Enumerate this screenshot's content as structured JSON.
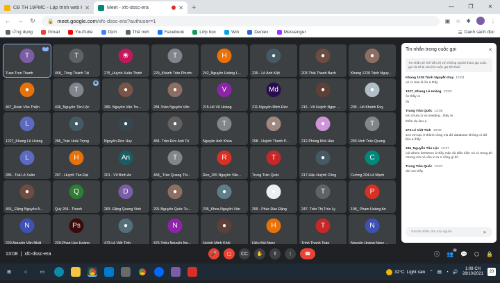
{
  "browser": {
    "tabs": [
      {
        "title": "CĐ TH 19PMC - Lập trình web PH",
        "favicon_color": "#f4b400",
        "active": false
      },
      {
        "title": "Meet - xfc-dssc-era",
        "favicon_color": "#00897b",
        "active": true
      }
    ],
    "url_host": "meet.google.com",
    "url_path": "/xfc-dssc-era?authuser=1",
    "bookmarks": [
      {
        "label": "Ứng dụng",
        "color": "#5f6368"
      },
      {
        "label": "Gmail",
        "color": "#ea4335"
      },
      {
        "label": "YouTube",
        "color": "#ff0000"
      },
      {
        "label": "Dịch",
        "color": "#4285f4"
      },
      {
        "label": "Thẻ mới",
        "color": "#5f6368"
      },
      {
        "label": "Facebook",
        "color": "#1877f2"
      },
      {
        "label": "Lớp học",
        "color": "#0f9d58"
      },
      {
        "label": "Win",
        "color": "#00a4ef"
      },
      {
        "label": "Deniex",
        "color": "#3367d6"
      },
      {
        "label": "Messenger",
        "color": "#a033ff"
      }
    ],
    "reading_list": "Danh sách đọc"
  },
  "participants": [
    {
      "name": "Tuan Tran Thanh",
      "initial": "T",
      "color": "#7b5ea7",
      "selected": true
    },
    {
      "name": "458_ Tống Thành Tài",
      "initial": "T",
      "color": "#5f6368"
    },
    {
      "name": "275_Huỳnh Xuân Thịnh",
      "initial": "❀",
      "color": "#c2185b"
    },
    {
      "name": "229_Khánh Trần Phước",
      "initial": "T",
      "color": "#80868b"
    },
    {
      "name": "242_Nguyễn Hoàng L...",
      "initial": "H",
      "color": "#e8710a"
    },
    {
      "name": "239 - Lê Anh Kiệt",
      "initial": "●",
      "color": "#455a64"
    },
    {
      "name": "203-Thái Thanh Bạch",
      "initial": "●",
      "color": "#6d4c41"
    },
    {
      "name": "Khang 1228 Trịnh Nguy...",
      "initial": "●",
      "color": "#8d6e63"
    },
    {
      "name": "467_Đoàn Văn Thiện",
      "initial": "●",
      "color": "#e8710a"
    },
    {
      "name": "436_Nguyễn Tấn Lộc",
      "initial": "T",
      "color": "#80868b"
    },
    {
      "name": "289- Nguyễn Văn Tru...",
      "initial": "●",
      "color": "#795548"
    },
    {
      "name": "284-Toàn Nguyễn Văn",
      "initial": "●",
      "color": "#8d6e63"
    },
    {
      "name": "215-Hồ Vũ Hoàng",
      "initial": "V",
      "color": "#8e24aa"
    },
    {
      "name": "211-Nguyễn Minh Đức",
      "initial": "Md",
      "color": "#2a0b4f"
    },
    {
      "name": "216 - Võ Huỳnh Ngọc ...",
      "initial": "●",
      "color": "#5d4037"
    },
    {
      "name": "205 - Hồ Khánh Duy",
      "initial": "●",
      "color": "#b0bec5"
    },
    {
      "name": "1227_Khang Lê Hoàng",
      "initial": "L",
      "color": "#5c6bc0"
    },
    {
      "name": "286_Trần Hoài Trọng",
      "initial": "●",
      "color": "#455a64"
    },
    {
      "name": "Nguyễn Đức Huy",
      "initial": "●",
      "color": "#37474f"
    },
    {
      "name": "484- Trần Đức Anh Tú",
      "initial": "●",
      "color": "#616161"
    },
    {
      "name": "Nguyễn Anh Khoa",
      "initial": "T",
      "color": "#80868b"
    },
    {
      "name": "298 - Huỳnh Thanh P...",
      "initial": "●",
      "color": "#a1887f"
    },
    {
      "name": "212-Phùng Khả Hào",
      "initial": "●",
      "color": "#ce93d8"
    },
    {
      "name": "293-Vinh Trần Quang",
      "initial": "T",
      "color": "#80868b"
    },
    {
      "name": "285 - Toả Lê Xuân",
      "initial": "L",
      "color": "#5c6bc0"
    },
    {
      "name": "207 - Huỳnh Tấn Đạt",
      "initial": "H",
      "color": "#e8710a"
    },
    {
      "name": "201 - Võ Bình An",
      "initial": "An",
      "color": "#1a5e63"
    },
    {
      "name": "468_ Trần Quang Thi...",
      "initial": "T",
      "color": "#80868b"
    },
    {
      "name": "Ren_265 Nguyễn Văn...",
      "initial": "R",
      "color": "#d93025"
    },
    {
      "name": "Trung Trần Quốc",
      "initial": "T",
      "color": "#c62828"
    },
    {
      "name": "217-Hậu Huỳnh Công",
      "initial": "●",
      "color": "#455a64"
    },
    {
      "name": "Cường 204-Lê Mạnh",
      "initial": "C",
      "color": "#00897b"
    },
    {
      "name": "466_ Đặng Nguyễn A...",
      "initial": "●",
      "color": "#6d4c41"
    },
    {
      "name": "Quý 264 - Thanh",
      "initial": "Q",
      "color": "#2e7d32"
    },
    {
      "name": "283- Đặng Quang Vinh",
      "initial": "D",
      "color": "#7b5ea7"
    },
    {
      "name": "291-Nguyễn Quốc Tu...",
      "initial": "●",
      "color": "#8d6e63"
    },
    {
      "name": "235_Khoa Nguyễn Văn",
      "initial": "●",
      "color": "#607d8b"
    },
    {
      "name": "259 - Phúc Đào Đặng",
      "initial": "●",
      "color": "#eceff1"
    },
    {
      "name": "247- Trần Thị Trúc Ly",
      "initial": "T",
      "color": "#5f6368"
    },
    {
      "name": "198_ Phạm Hoàng An",
      "initial": "P",
      "color": "#d93025"
    },
    {
      "name": "220-Nguyễn Văn Nhật",
      "initial": "N",
      "color": "#3f51b5"
    },
    {
      "name": "220-Phan Huy Hoàng",
      "initial": "Ps",
      "color": "#3b0a0a"
    },
    {
      "name": "473-Lê Việt Tình",
      "initial": "●",
      "color": "#546e7a"
    },
    {
      "name": "476-Triều Nguyễn Ng...",
      "initial": "N",
      "color": "#8e24aa"
    },
    {
      "name": "Huỳnh Minh Khôi",
      "initial": "●",
      "color": "#5d4037"
    },
    {
      "name": "Hiếu Bùi Ngọc",
      "initial": "H",
      "color": "#e8710a"
    },
    {
      "name": "Trịnh Thanh Toàn",
      "initial": "T",
      "color": "#c62828"
    },
    {
      "name": "Nguyễn Hoàng Ngọc ...",
      "initial": "N",
      "color": "#3f51b5"
    }
  ],
  "chat": {
    "title": "Tin nhắn trong cuộc gọi",
    "notice": "Tin nhắn sẽ chỉ hiển thị với những người tham gia cuộc gọi và sẽ bị xóa khi cuộc gọi kết thúc",
    "messages": [
      {
        "sender": "Khang 1228 Trịnh Nguyễn Duy",
        "time": "13:03",
        "lines": [
          "vô cv bản là ổn á thầy"
        ]
      },
      {
        "sender": "1227_Khang Lê Hoàng",
        "time": "13:03",
        "lines": [
          "ổn thầy ơi",
          "ổn"
        ]
      },
      {
        "sender": "Trung Trần Quốc",
        "time": "13:05",
        "lines": [
          "em chưa có vs seeding , thầy ơi",
          "thêm dụ lieu ạ"
        ]
      },
      {
        "sender": "473-Lê Việt Tình",
        "time": "13:06",
        "lines": [
          "seo em tạo ở thành công mà dữ database không có dữ liệu ạ thầy"
        ]
      },
      {
        "sender": "436_Nguyễn Tấn Lộc",
        "time": "13:07",
        "lines": [
          "cái where betWeen á thầy mặc dù điều kiện nó có trong đó nhưng mà nó vẫn in ra 1 công gì đó"
        ]
      },
      {
        "sender": "Trung Trần Quốc",
        "time": "13:07",
        "lines": [
          "dời em thầy"
        ]
      }
    ],
    "input_placeholder": "Gửi tin nhắn cho mọi người"
  },
  "bottom": {
    "time": "13:08",
    "meeting_code": "xfc-dssc-era",
    "participant_count": "48"
  },
  "taskbar": {
    "temperature": "32°C",
    "weather": "Light rain",
    "clock_time": "1:08 CH",
    "clock_date": "28/10/2021",
    "notifications": "20"
  }
}
